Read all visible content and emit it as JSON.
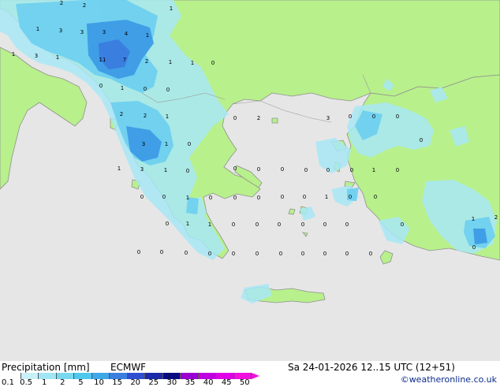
{
  "footer": {
    "title_left": "Precipitation [mm]",
    "model": "ECMWF",
    "datetime": "Sa 24-01-2026 12..15 UTC (12+51)",
    "credit": "©weatheronline.co.uk"
  },
  "legend": {
    "ticks": [
      "0.1",
      "0.5",
      "1",
      "2",
      "5",
      "10",
      "15",
      "20",
      "25",
      "30",
      "35",
      "40",
      "45",
      "50"
    ],
    "colors": [
      "#ffffff",
      "#c8f0f8",
      "#a0e6f4",
      "#78d8f0",
      "#50c8ee",
      "#3fa8e8",
      "#3a7fe0",
      "#2f4fd0",
      "#1a2aa8",
      "#0a0a80",
      "#9a00d0",
      "#c000e0",
      "#e000e8",
      "#f010e0"
    ]
  },
  "map_values": [
    "2",
    "2",
    "1",
    "1",
    "3",
    "3",
    "3",
    "4",
    "1",
    "1",
    "3",
    "11",
    "7",
    "2",
    "1",
    "1",
    "0",
    "1",
    "0",
    "1",
    "0",
    "0",
    "2",
    "2",
    "1",
    "0",
    "2",
    "3",
    "1",
    "0",
    "1",
    "3",
    "1",
    "0",
    "0",
    "0",
    "0",
    "0",
    "0",
    "0",
    "1",
    "0",
    "0",
    "0",
    "1",
    "0",
    "0",
    "0",
    "0",
    "0",
    "1",
    "0",
    "0",
    "0",
    "1",
    "1",
    "0",
    "0",
    "0",
    "0",
    "0",
    "0",
    "0",
    "0",
    "0",
    "0",
    "0",
    "0",
    "0",
    "0",
    "0",
    "0",
    "0",
    "0",
    "1",
    "2",
    "0",
    "3",
    "0",
    "0",
    "0",
    "0"
  ]
}
